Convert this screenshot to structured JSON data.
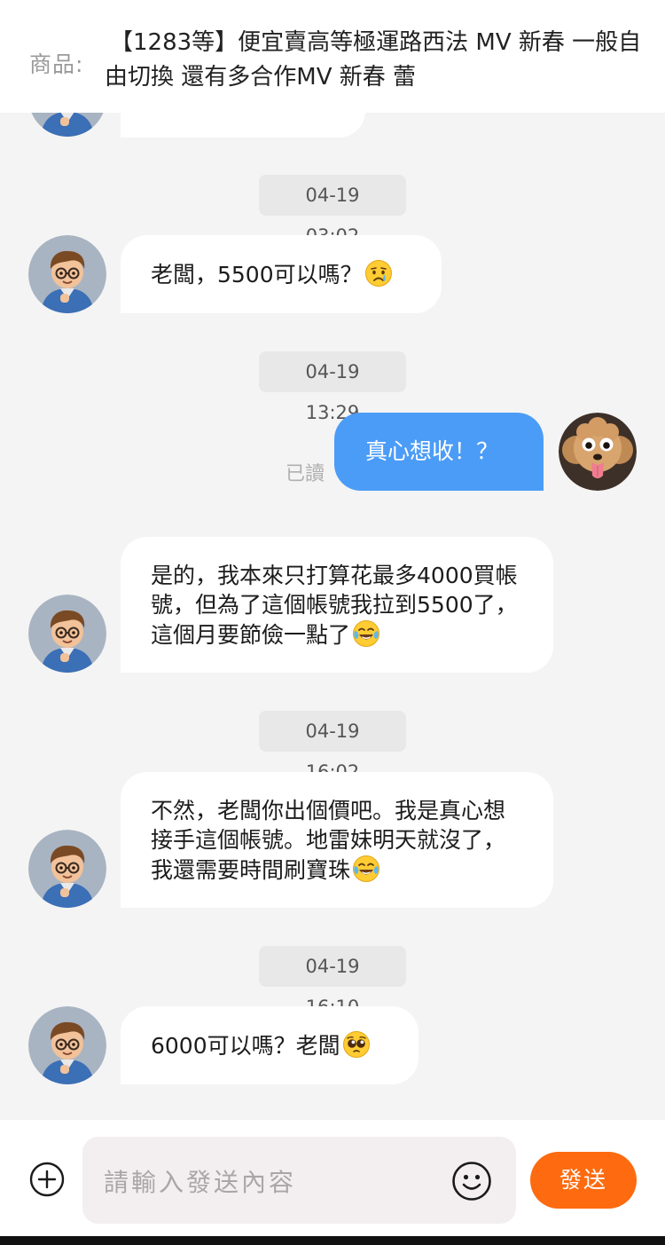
{
  "product": {
    "label": "商品:",
    "title": "【1283等】便宜賣高等極運路西法 MV 新春 一般自由切換 還有多合作MV 新春 蕾"
  },
  "messages": [
    {
      "id": "m1",
      "timestamp": "04-19 03:02",
      "from": "buyer",
      "text": "老闆，5500可以嗎？",
      "emoji": "crying-face"
    },
    {
      "id": "m2",
      "timestamp": "04-19 13:29",
      "from": "me",
      "text": "真心想收！？",
      "read_status": "已讀"
    },
    {
      "id": "m3",
      "from": "buyer",
      "text": "是的，我本來只打算花最多4000買帳號，但為了這個帳號我拉到5500了，這個月要節儉一點了",
      "emoji": "tears-of-joy"
    },
    {
      "id": "m4",
      "timestamp": "04-19 16:02",
      "from": "buyer",
      "text": "不然，老闆你出個價吧。我是真心想接手這個帳號。地雷妹明天就沒了，我還需要時間刷寶珠",
      "emoji": "tears-of-joy"
    },
    {
      "id": "m5",
      "timestamp": "04-19 16:10",
      "from": "buyer",
      "text": "6000可以嗎？老闆",
      "emoji": "pleading-face"
    }
  ],
  "input": {
    "placeholder": "請輸入發送內容",
    "send_label": "發送"
  },
  "colors": {
    "outgoing_bubble": "#4b9cf7",
    "send_button": "#fd6a0f",
    "background": "#f4f4f4"
  }
}
